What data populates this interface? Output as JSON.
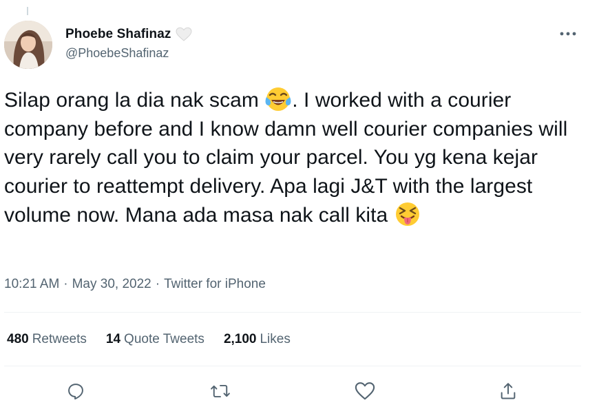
{
  "author": {
    "display_name": "Phoebe Shafinaz",
    "handle": "@PhoebeShafinaz",
    "badge_icon": "white-heart-icon"
  },
  "tweet": {
    "text_parts": [
      "Silap orang la dia nak scam ",
      ". I worked with a courier company before and I know damn well courier companies will very rarely call you to claim your parcel. You yg kena kejar courier to reattempt delivery. Apa lagi J&T with the largest volume now. Mana ada masa nak call kita "
    ],
    "emojis": [
      "face-with-tears-of-joy",
      "squinting-face-with-tongue"
    ],
    "time": "10:21 AM",
    "date": "May 30, 2022",
    "source": "Twitter for iPhone",
    "separator": "·"
  },
  "stats": {
    "retweets_count": "480",
    "retweets_label": "Retweets",
    "quotes_count": "14",
    "quotes_label": "Quote Tweets",
    "likes_count": "2,100",
    "likes_label": "Likes"
  },
  "actions": [
    "reply-icon",
    "retweet-icon",
    "like-icon",
    "share-icon"
  ],
  "colors": {
    "text": "#0f1419",
    "secondary": "#536471",
    "divider": "#eff3f4"
  }
}
